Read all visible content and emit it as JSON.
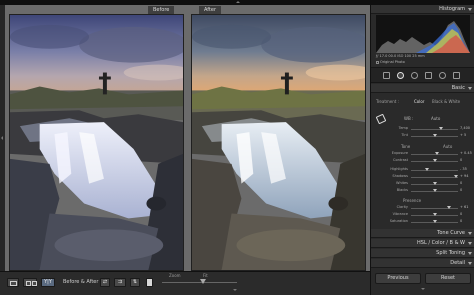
{
  "view": {
    "before_label": "Before",
    "after_label": "After"
  },
  "toolbar": {
    "mode_label": "Before & After :",
    "zoom_label": "Zoom",
    "fit_label": "Fit"
  },
  "panel": {
    "histogram_title": "Histogram",
    "readout": "ƒ/ 17.0  00.0  ISO 100  25 mm",
    "original_photo": "Original Photo",
    "basic_title": "Basic",
    "treatment_label": "Treatment :",
    "treatment_color": "Color",
    "treatment_bw": "Black & White",
    "wb_label": "WB :",
    "wb_value": "Auto",
    "temp": {
      "label": "Temp",
      "value": "7,400",
      "level": 0.64
    },
    "tint": {
      "label": "Tint",
      "value": "+ 5",
      "level": 0.52
    },
    "tone_label": "Tone",
    "tone_auto": "Auto",
    "exposure": {
      "label": "Exposure",
      "value": "+ 0.45",
      "level": 0.55
    },
    "contrast": {
      "label": "Contrast",
      "value": "0",
      "level": 0.5
    },
    "highlights": {
      "label": "Highlights",
      "value": "- 35",
      "level": 0.33
    },
    "shadows": {
      "label": "Shadows",
      "value": "+ 94",
      "level": 0.96
    },
    "whites": {
      "label": "Whites",
      "value": "0",
      "level": 0.5
    },
    "blacks": {
      "label": "Blacks",
      "value": "0",
      "level": 0.5
    },
    "presence_label": "Presence",
    "clarity": {
      "label": "Clarity",
      "value": "+ 61",
      "level": 0.8
    },
    "vibrance": {
      "label": "Vibrance",
      "value": "0",
      "level": 0.5
    },
    "saturation": {
      "label": "Saturation",
      "value": "0",
      "level": 0.5
    },
    "tone_curve_title": "Tone Curve",
    "hsl_title": "HSL  /  Color  /  B & W",
    "split_toning_title": "Split Toning",
    "detail_title": "Detail",
    "previous_label": "Previous",
    "reset_label": "Reset"
  },
  "colors": {
    "panel_bg": "#2a2a2a",
    "view_bg": "#6b6b6b",
    "accent_text": "#d8d8d8"
  }
}
